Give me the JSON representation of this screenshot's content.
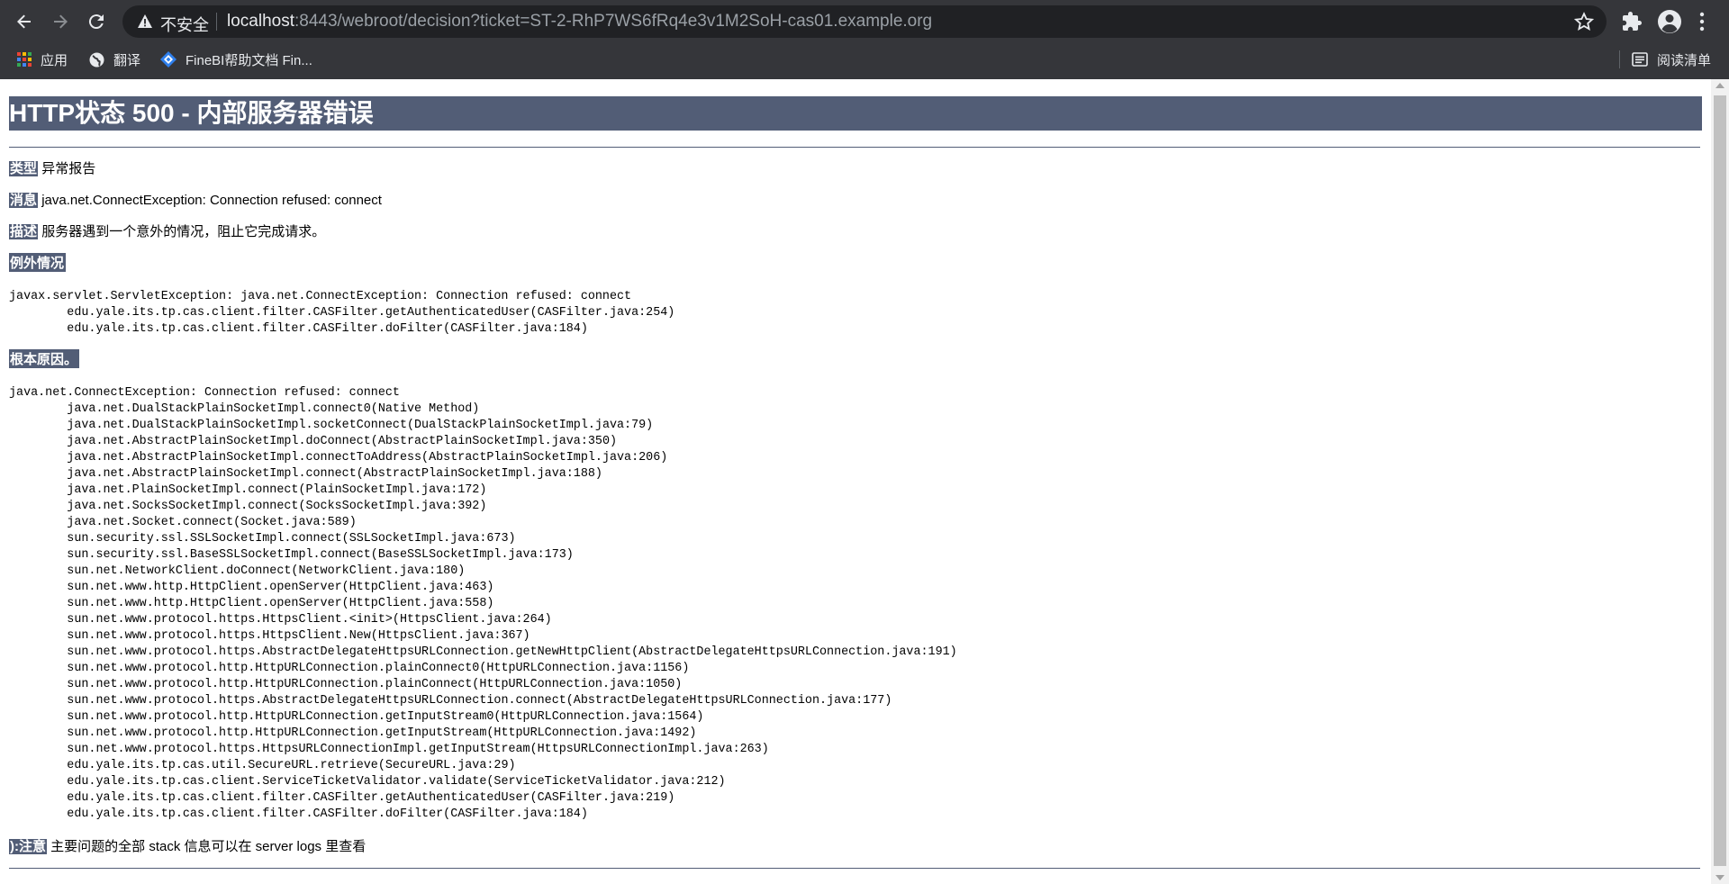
{
  "browser": {
    "insecure_label": "不安全",
    "url_host": "localhost",
    "url_rest": ":8443/webroot/decision?ticket=ST-2-RhP7WS6fRq4e3v1M2SoH-cas01.example.org",
    "bookmarks": [
      {
        "label": "应用",
        "icon": "apps-grid-icon"
      },
      {
        "label": "翻译",
        "icon": "globe-icon"
      },
      {
        "label": "FineBI帮助文档 Fin...",
        "icon": "finebi-icon"
      }
    ],
    "reading_list_label": "阅读清单"
  },
  "error": {
    "title": "HTTP状态 500 - 内部服务器错误",
    "type_label": "类型",
    "type_value": "异常报告",
    "message_label": "消息",
    "message_value": "java.net.ConnectException: Connection refused: connect",
    "description_label": "描述",
    "description_value": "服务器遇到一个意外的情况，阻止它完成请求。",
    "exception_label": "例外情况",
    "exception_trace": "javax.servlet.ServletException: java.net.ConnectException: Connection refused: connect\n\tedu.yale.its.tp.cas.client.filter.CASFilter.getAuthenticatedUser(CASFilter.java:254)\n\tedu.yale.its.tp.cas.client.filter.CASFilter.doFilter(CASFilter.java:184)",
    "root_cause_label": "根本原因。",
    "root_cause_trace": "java.net.ConnectException: Connection refused: connect\n\tjava.net.DualStackPlainSocketImpl.connect0(Native Method)\n\tjava.net.DualStackPlainSocketImpl.socketConnect(DualStackPlainSocketImpl.java:79)\n\tjava.net.AbstractPlainSocketImpl.doConnect(AbstractPlainSocketImpl.java:350)\n\tjava.net.AbstractPlainSocketImpl.connectToAddress(AbstractPlainSocketImpl.java:206)\n\tjava.net.AbstractPlainSocketImpl.connect(AbstractPlainSocketImpl.java:188)\n\tjava.net.PlainSocketImpl.connect(PlainSocketImpl.java:172)\n\tjava.net.SocksSocketImpl.connect(SocksSocketImpl.java:392)\n\tjava.net.Socket.connect(Socket.java:589)\n\tsun.security.ssl.SSLSocketImpl.connect(SSLSocketImpl.java:673)\n\tsun.security.ssl.BaseSSLSocketImpl.connect(BaseSSLSocketImpl.java:173)\n\tsun.net.NetworkClient.doConnect(NetworkClient.java:180)\n\tsun.net.www.http.HttpClient.openServer(HttpClient.java:463)\n\tsun.net.www.http.HttpClient.openServer(HttpClient.java:558)\n\tsun.net.www.protocol.https.HttpsClient.<init>(HttpsClient.java:264)\n\tsun.net.www.protocol.https.HttpsClient.New(HttpsClient.java:367)\n\tsun.net.www.protocol.https.AbstractDelegateHttpsURLConnection.getNewHttpClient(AbstractDelegateHttpsURLConnection.java:191)\n\tsun.net.www.protocol.http.HttpURLConnection.plainConnect0(HttpURLConnection.java:1156)\n\tsun.net.www.protocol.http.HttpURLConnection.plainConnect(HttpURLConnection.java:1050)\n\tsun.net.www.protocol.https.AbstractDelegateHttpsURLConnection.connect(AbstractDelegateHttpsURLConnection.java:177)\n\tsun.net.www.protocol.http.HttpURLConnection.getInputStream0(HttpURLConnection.java:1564)\n\tsun.net.www.protocol.http.HttpURLConnection.getInputStream(HttpURLConnection.java:1492)\n\tsun.net.www.protocol.https.HttpsURLConnectionImpl.getInputStream(HttpsURLConnectionImpl.java:263)\n\tedu.yale.its.tp.cas.util.SecureURL.retrieve(SecureURL.java:29)\n\tedu.yale.its.tp.cas.client.ServiceTicketValidator.validate(ServiceTicketValidator.java:212)\n\tedu.yale.its.tp.cas.client.filter.CASFilter.getAuthenticatedUser(CASFilter.java:219)\n\tedu.yale.its.tp.cas.client.filter.CASFilter.doFilter(CASFilter.java:184)",
    "note_label": "):注意",
    "note_value": "主要问题的全部 stack 信息可以在 server logs 里查看"
  }
}
